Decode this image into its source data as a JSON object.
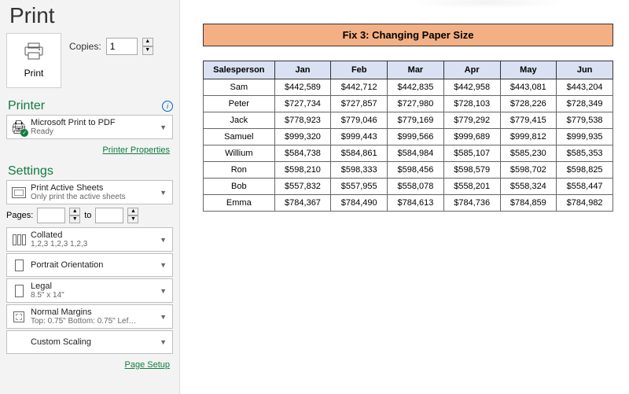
{
  "title": "Print",
  "print": {
    "button": "Print",
    "copies_label": "Copies:",
    "copies_value": "1"
  },
  "printer": {
    "heading": "Printer",
    "name": "Microsoft Print to PDF",
    "status": "Ready",
    "properties_link": "Printer Properties"
  },
  "settings": {
    "heading": "Settings",
    "sheets": {
      "line1": "Print Active Sheets",
      "line2": "Only print the active sheets"
    },
    "pages": {
      "label": "Pages:",
      "to": "to",
      "from": "",
      "until": ""
    },
    "collate": {
      "line1": "Collated",
      "line2": "1,2,3   1,2,3   1,2,3"
    },
    "orientation": {
      "line1": "Portrait Orientation"
    },
    "paper": {
      "line1": "Legal",
      "line2": "8.5\" x 14\""
    },
    "margins": {
      "line1": "Normal Margins",
      "line2": "Top: 0.75\" Bottom: 0.75\" Lef…"
    },
    "scaling": {
      "line1": "Custom Scaling"
    },
    "page_setup_link": "Page Setup"
  },
  "chart_data": {
    "type": "table",
    "title": "Fix 3: Changing Paper Size",
    "columns": [
      "Salesperson",
      "Jan",
      "Feb",
      "Mar",
      "Apr",
      "May",
      "Jun"
    ],
    "rows": [
      [
        "Sam",
        "$442,589",
        "$442,712",
        "$442,835",
        "$442,958",
        "$443,081",
        "$443,204"
      ],
      [
        "Peter",
        "$727,734",
        "$727,857",
        "$727,980",
        "$728,103",
        "$728,226",
        "$728,349"
      ],
      [
        "Jack",
        "$778,923",
        "$779,046",
        "$779,169",
        "$779,292",
        "$779,415",
        "$779,538"
      ],
      [
        "Samuel",
        "$999,320",
        "$999,443",
        "$999,566",
        "$999,689",
        "$999,812",
        "$999,935"
      ],
      [
        "Willium",
        "$584,738",
        "$584,861",
        "$584,984",
        "$585,107",
        "$585,230",
        "$585,353"
      ],
      [
        "Ron",
        "$598,210",
        "$598,333",
        "$598,456",
        "$598,579",
        "$598,702",
        "$598,825"
      ],
      [
        "Bob",
        "$557,832",
        "$557,955",
        "$558,078",
        "$558,201",
        "$558,324",
        "$558,447"
      ],
      [
        "Emma",
        "$784,367",
        "$784,490",
        "$784,613",
        "$784,736",
        "$784,859",
        "$784,982"
      ]
    ]
  }
}
